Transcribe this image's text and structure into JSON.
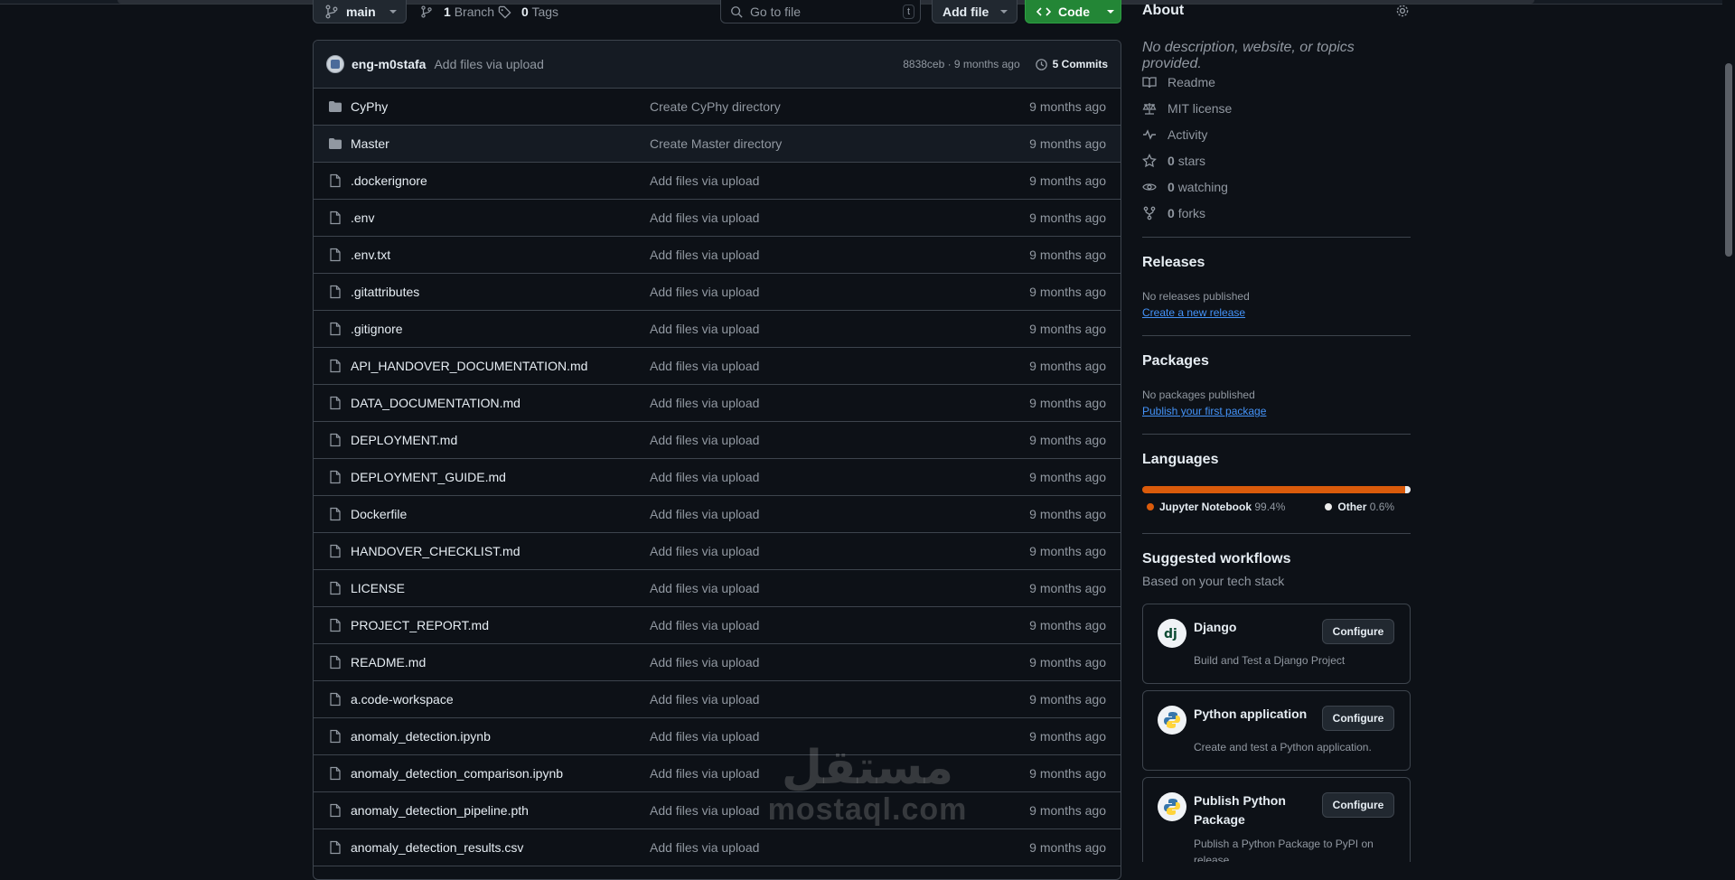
{
  "repo": {
    "branch": "main",
    "branches_count": "1",
    "branches_label": "Branch",
    "tags_count": "0",
    "tags_label": "Tags",
    "go_to_file_placeholder": "Go to file",
    "go_to_file_shortcut": "t",
    "add_file_label": "Add file",
    "code_label": "Code"
  },
  "commit": {
    "author": "eng-m0stafa",
    "message": "Add files via upload",
    "hash_time": "8838ceb · 9 months ago",
    "commits_label": "5 Commits"
  },
  "files": [
    {
      "name": "CyPhy",
      "type": "folder",
      "message": "Create CyPhy directory",
      "age": "9 months ago"
    },
    {
      "name": "Master",
      "type": "folder",
      "message": "Create Master directory",
      "age": "9 months ago"
    },
    {
      "name": ".dockerignore",
      "type": "file",
      "message": "Add files via upload",
      "age": "9 months ago"
    },
    {
      "name": ".env",
      "type": "file",
      "message": "Add files via upload",
      "age": "9 months ago"
    },
    {
      "name": ".env.txt",
      "type": "file",
      "message": "Add files via upload",
      "age": "9 months ago"
    },
    {
      "name": ".gitattributes",
      "type": "file",
      "message": "Add files via upload",
      "age": "9 months ago"
    },
    {
      "name": ".gitignore",
      "type": "file",
      "message": "Add files via upload",
      "age": "9 months ago"
    },
    {
      "name": "API_HANDOVER_DOCUMENTATION.md",
      "type": "file",
      "message": "Add files via upload",
      "age": "9 months ago"
    },
    {
      "name": "DATA_DOCUMENTATION.md",
      "type": "file",
      "message": "Add files via upload",
      "age": "9 months ago"
    },
    {
      "name": "DEPLOYMENT.md",
      "type": "file",
      "message": "Add files via upload",
      "age": "9 months ago"
    },
    {
      "name": "DEPLOYMENT_GUIDE.md",
      "type": "file",
      "message": "Add files via upload",
      "age": "9 months ago"
    },
    {
      "name": "Dockerfile",
      "type": "file",
      "message": "Add files via upload",
      "age": "9 months ago"
    },
    {
      "name": "HANDOVER_CHECKLIST.md",
      "type": "file",
      "message": "Add files via upload",
      "age": "9 months ago"
    },
    {
      "name": "LICENSE",
      "type": "file",
      "message": "Add files via upload",
      "age": "9 months ago"
    },
    {
      "name": "PROJECT_REPORT.md",
      "type": "file",
      "message": "Add files via upload",
      "age": "9 months ago"
    },
    {
      "name": "README.md",
      "type": "file",
      "message": "Add files via upload",
      "age": "9 months ago"
    },
    {
      "name": "a.code-workspace",
      "type": "file",
      "message": "Add files via upload",
      "age": "9 months ago"
    },
    {
      "name": "anomaly_detection.ipynb",
      "type": "file",
      "message": "Add files via upload",
      "age": "9 months ago"
    },
    {
      "name": "anomaly_detection_comparison.ipynb",
      "type": "file",
      "message": "Add files via upload",
      "age": "9 months ago"
    },
    {
      "name": "anomaly_detection_pipeline.pth",
      "type": "file",
      "message": "Add files via upload",
      "age": "9 months ago"
    },
    {
      "name": "anomaly_detection_results.csv",
      "type": "file",
      "message": "Add files via upload",
      "age": "9 months ago"
    }
  ],
  "about": {
    "title": "About",
    "description": "No description, website, or topics provided.",
    "readme": "Readme",
    "license": "MIT license",
    "activity": "Activity",
    "stars_count": "0",
    "stars_label": "stars",
    "watching_count": "0",
    "watching_label": "watching",
    "forks_count": "0",
    "forks_label": "forks"
  },
  "releases": {
    "title": "Releases",
    "status": "No releases published",
    "link": "Create a new release"
  },
  "packages": {
    "title": "Packages",
    "status": "No packages published",
    "link": "Publish your first package"
  },
  "languages": {
    "title": "Languages",
    "items": [
      {
        "name": "Jupyter Notebook",
        "percent": "99.4%",
        "value": 99.4,
        "color": "#da5b0b"
      },
      {
        "name": "Other",
        "percent": "0.6%",
        "value": 0.6,
        "color": "#ededed"
      }
    ]
  },
  "workflows": {
    "title": "Suggested workflows",
    "subtitle": "Based on your tech stack",
    "configure_label": "Configure",
    "items": [
      {
        "name": "Django",
        "description": "Build and Test a Django Project",
        "logo": "django-logo"
      },
      {
        "name": "Python application",
        "description": "Create and test a Python application.",
        "logo": "python-logo"
      },
      {
        "name": "Publish Python Package",
        "description": "Publish a Python Package to PyPI on release.",
        "logo": "python-logo"
      }
    ]
  },
  "watermark": {
    "arabic": "مستقل",
    "latin": "mostaql.com"
  },
  "colors": {
    "accent_green": "#238636",
    "link_blue": "#4493f8",
    "jupyter_orange": "#da5b0b"
  }
}
